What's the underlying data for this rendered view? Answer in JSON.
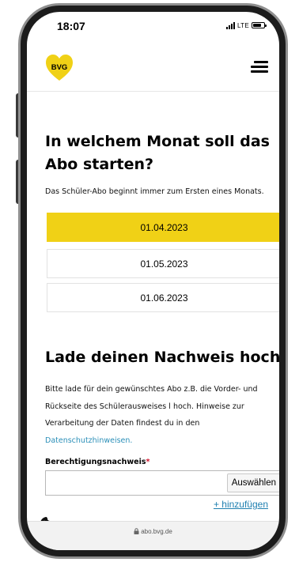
{
  "status_bar": {
    "time": "18:07",
    "network": "LTE",
    "signal_icon": "signal-bars-icon",
    "battery_icon": "battery-icon"
  },
  "header": {
    "logo_text": "BVG",
    "logo_color": "#f0d116",
    "menu_icon": "hamburger-menu-icon"
  },
  "start_section": {
    "title_line1": "In welchem Monat soll das",
    "title_line2": "Abo starten?",
    "description": "Das Schüler-Abo beginnt immer zum Ersten eines Monats.",
    "options": [
      {
        "label": "01.04.2023",
        "selected": true
      },
      {
        "label": "01.05.2023",
        "selected": false
      },
      {
        "label": "01.06.2023",
        "selected": false
      }
    ],
    "selected_color": "#f0d116"
  },
  "proof_section": {
    "title": "Lade deinen Nachweis hoch",
    "text_line1": "Bitte lade für dein gewünschtes Abo z.B. die Vorder- und",
    "text_line2": "Rückseite des Schülerausweises l hoch. Hinweise zur",
    "text_line3": "Verarbeitung der Daten findest du in den",
    "privacy_link": "Datenschutzhinweisen.",
    "field_label": "Berechtigungsnachweis",
    "required_mark": "*",
    "choose_button": "Auswählen",
    "add_link": "+ hinzufügen"
  },
  "bottom_bar": {
    "url": "abo.bvg.de",
    "cookie_icon": "cookie-icon"
  }
}
